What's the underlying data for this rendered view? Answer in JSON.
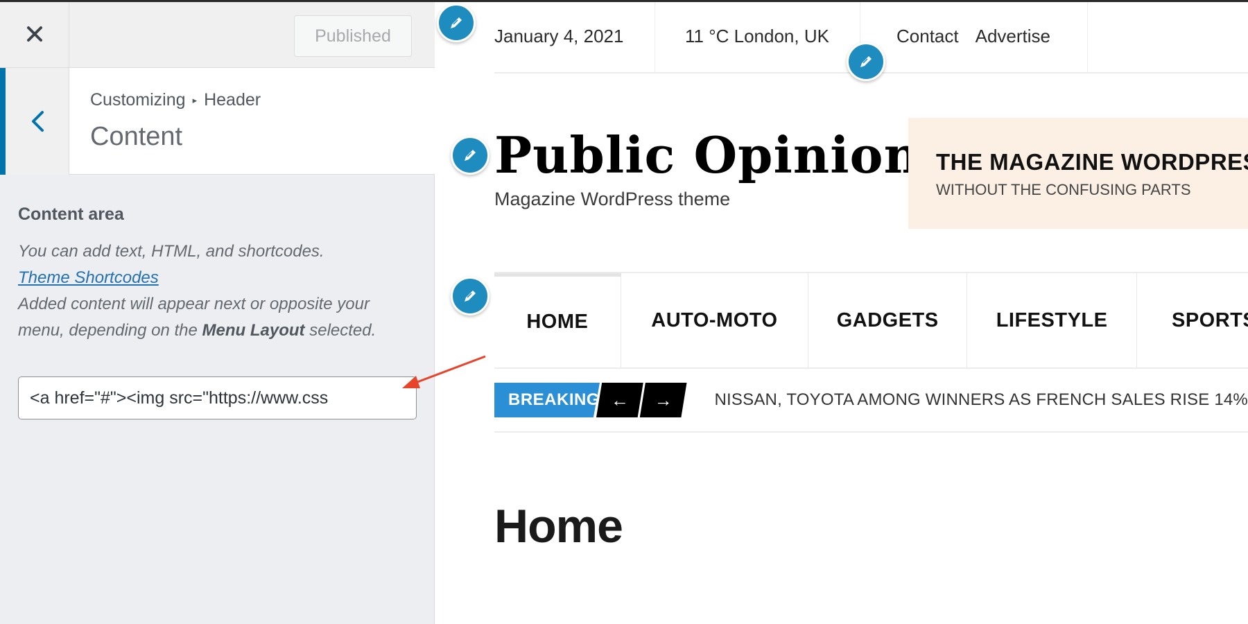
{
  "customizer": {
    "close_label": "Close",
    "publish_button": "Published",
    "breadcrumb": {
      "parent": "Customizing",
      "separator": "▸",
      "section": "Header"
    },
    "section_title": "Content",
    "control": {
      "title": "Content area",
      "desc_line1": "You can add text, HTML, and shortcodes.",
      "link_text": "Theme Shortcodes",
      "desc_line2_pre": "Added content will appear next or opposite your menu, depending on the ",
      "desc_line2_bold": "Menu Layout",
      "desc_line2_post": " selected.",
      "input_value": "<a href=\"#\"><img src=\"https://www.css"
    }
  },
  "preview": {
    "topbar": {
      "date": "January 4, 2021",
      "weather": "11 °C London, UK",
      "links": [
        "Contact",
        "Advertise"
      ]
    },
    "site_title": "Public Opinion",
    "site_tagline": "Magazine WordPress theme",
    "ad": {
      "headline": "THE MAGAZINE WORDPRESS THEME",
      "subline": "WITHOUT THE CONFUSING PARTS"
    },
    "nav": [
      "HOME",
      "AUTO-MOTO",
      "GADGETS",
      "LIFESTYLE",
      "SPORTS"
    ],
    "breaking": {
      "label": "BREAKING",
      "prev": "←",
      "next": "→",
      "headline": "NISSAN, TOYOTA AMONG WINNERS AS FRENCH SALES RISE 14%"
    },
    "page_title": "Home"
  },
  "colors": {
    "accent": "#0073aa",
    "edit_shortcut": "#1e8cbe",
    "breaking": "#2b8fd6",
    "annotation_arrow": "#e8442a",
    "ad_background": "#fcf0e4"
  }
}
